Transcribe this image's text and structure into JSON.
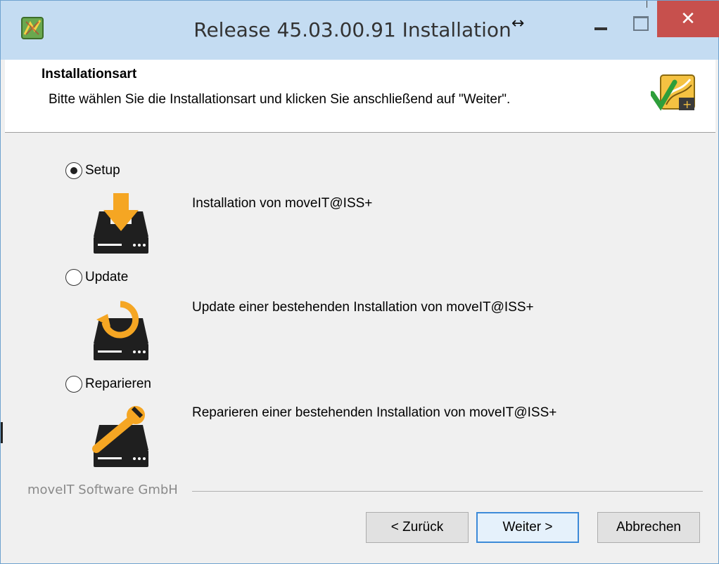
{
  "window": {
    "title": "Release 45.03.00.91 Installation",
    "close_glyph": "✕",
    "resize_glyph": "↔"
  },
  "header": {
    "title": "Installationsart",
    "subtitle": "Bitte wählen Sie die Installationsart und klicken Sie anschließend auf \"Weiter\"."
  },
  "options": [
    {
      "label": "Setup",
      "description": "Installation von moveIT@ISS+",
      "selected": true,
      "icon": "download-drive-icon"
    },
    {
      "label": "Update",
      "description": "Update einer bestehenden Installation von moveIT@ISS+",
      "selected": false,
      "icon": "refresh-drive-icon"
    },
    {
      "label": "Reparieren",
      "description": "Reparieren einer bestehenden Installation von moveIT@ISS+",
      "selected": false,
      "icon": "wrench-drive-icon"
    }
  ],
  "footer": {
    "brand": "moveIT Software GmbH",
    "back_label": "< Zurück",
    "next_label": "Weiter >",
    "cancel_label": "Abbrechen"
  },
  "colors": {
    "titlebar": "#c4dcf2",
    "close_button": "#c7504d",
    "accent_orange": "#f5a623",
    "drive_dark": "#1f1f1f",
    "default_button_border": "#3c8ad8"
  }
}
